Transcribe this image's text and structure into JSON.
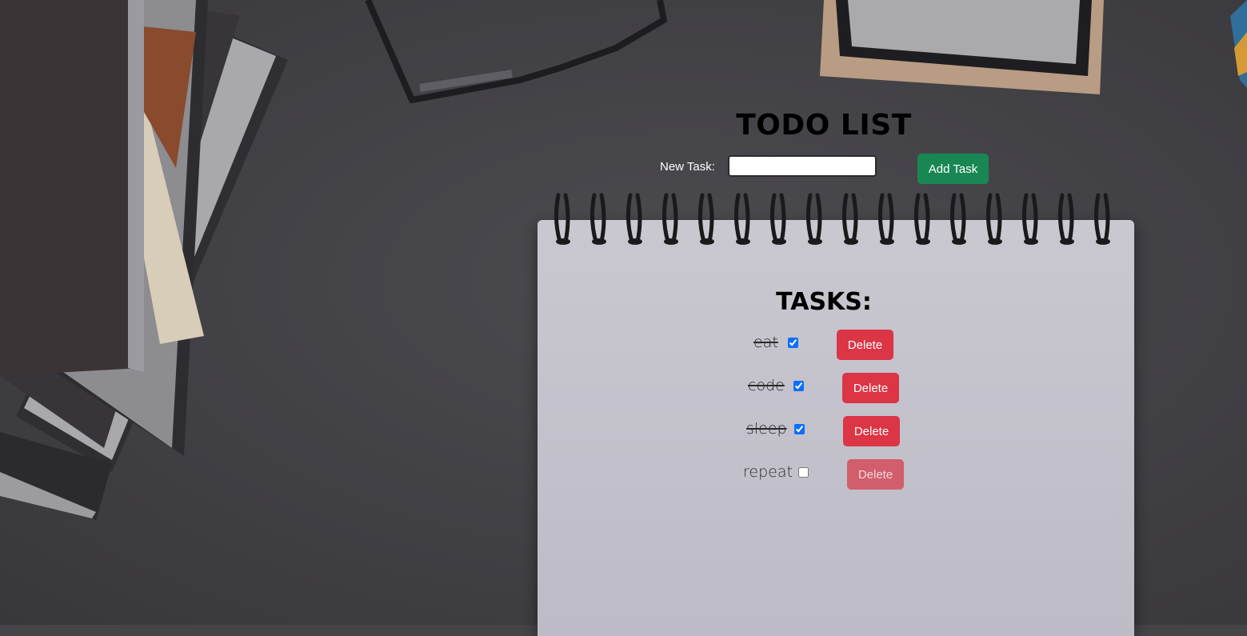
{
  "app": {
    "title": "TODO LIST"
  },
  "form": {
    "label": "New Task:",
    "input_value": "",
    "input_placeholder": "",
    "add_button_label": "Add Task"
  },
  "tasks": {
    "heading": "TASKS:",
    "items": [
      {
        "text": "eat",
        "done": true,
        "delete_label": "Delete"
      },
      {
        "text": "code",
        "done": true,
        "delete_label": "Delete"
      },
      {
        "text": "sleep",
        "done": true,
        "delete_label": "Delete"
      },
      {
        "text": "repeat",
        "done": false,
        "delete_label": "Delete"
      }
    ]
  },
  "colors": {
    "add_button": "#198754",
    "delete_button": "#dc3545",
    "background": "#454449",
    "notepad": "#c4c2cc"
  }
}
